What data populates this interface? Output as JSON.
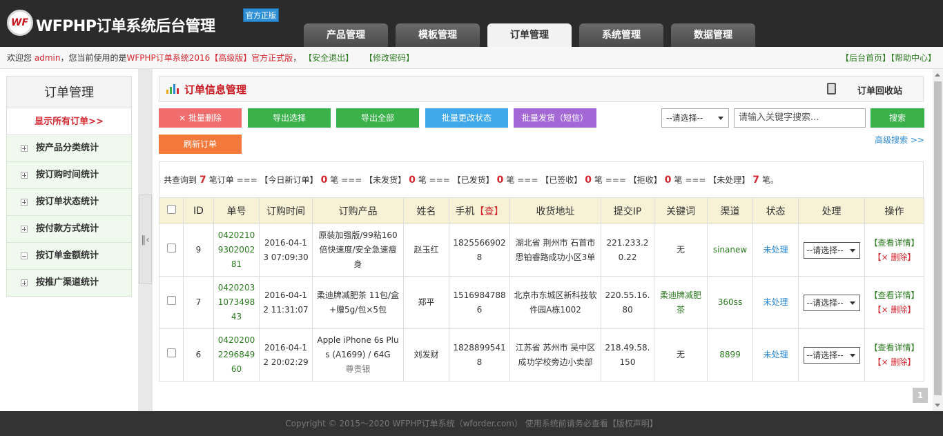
{
  "header": {
    "logo_mark": "WF",
    "logo_text": "WFPHP订单系统后台管理",
    "badge": "官方正版",
    "tabs": [
      "产品管理",
      "模板管理",
      "订单管理",
      "系统管理",
      "数据管理"
    ],
    "active_tab": "订单管理"
  },
  "infobar": {
    "welcome": "欢迎您",
    "user": "admin",
    "using": "，您当前使用的是",
    "edition": "WFPHP订单系统2016【高级版】官方正式版",
    "comma": "，",
    "logout": "【安全退出】",
    "change_pwd": "【修改密码】",
    "home": "【后台首页】",
    "help": "【帮助中心】"
  },
  "sidebar": {
    "title": "订单管理",
    "all_orders": "显示所有订单>>",
    "items": [
      {
        "label": "按产品分类统计",
        "state": "plus"
      },
      {
        "label": "按订购时间统计",
        "state": "plus"
      },
      {
        "label": "按订单状态统计",
        "state": "plus"
      },
      {
        "label": "按付款方式统计",
        "state": "plus"
      },
      {
        "label": "按订单金额统计",
        "state": "minus"
      },
      {
        "label": "按推广渠道统计",
        "state": "plus"
      }
    ]
  },
  "panel": {
    "title": "订单信息管理",
    "recycle_bin": "订单回收站"
  },
  "toolbar": {
    "batch_delete": "× 批量删除",
    "export_selected": "导出选择",
    "export_all": "导出全部",
    "batch_status": "批量更改状态",
    "batch_ship": "批量发货（短信）",
    "refresh": "刷新订单",
    "select_default": "--请选择--",
    "search_placeholder": "请输入关键字搜索...",
    "search_button": "搜索",
    "advanced_search": "高级搜索 >>"
  },
  "stats": {
    "prefix": "共查询到",
    "total": "7",
    "t1": "笔订单 === 【今日新订单】",
    "today": "0",
    "t2": "笔 === 【未发货】",
    "unshipped": "0",
    "t3": "笔 === 【已发货】",
    "shipped": "0",
    "t4": "笔 === 【已签收】",
    "signed": "0",
    "t5": "笔 === 【拒收】",
    "rejected": "0",
    "t6": "笔 === 【未处理】",
    "pending": "7",
    "t7": "笔。"
  },
  "table": {
    "columns": [
      "ID",
      "单号",
      "订购时间",
      "订购产品",
      "姓名",
      "手机",
      "【查】",
      "收货地址",
      "提交IP",
      "关键词",
      "渠道",
      "状态",
      "处理",
      "操作"
    ],
    "rows": [
      {
        "id": "9",
        "order_no": "04202109302002 81",
        "time": "2016-04-13 07:09:30",
        "product": "原装加强版/99粘160倍快速度/安全急速瘦身",
        "name": "赵玉红",
        "phone": "18255669028",
        "address": "湖北省 荆州市 石首市 思铂睿路成功小区3单",
        "ip": "221.233.20.22",
        "keyword": "无",
        "channel": "sinanew",
        "status": "未处理",
        "process": "--请选择--",
        "view": "【查看详情】",
        "delete": "【× 删除】"
      },
      {
        "id": "7",
        "order_no": "04202031073498 43",
        "time": "2016-04-12 11:31:07",
        "product": "柔迪牌减肥茶 11包/盒+赠5g/包×5包",
        "name": "郑平",
        "phone": "15169847886",
        "address": "北京市东城区新科技软件园A栋1002",
        "ip": "220.55.16.80",
        "keyword": "柔迪牌减肥茶",
        "channel": "360ss",
        "status": "未处理",
        "process": "--请选择--",
        "view": "【查看详情】",
        "delete": "【× 删除】"
      },
      {
        "id": "6",
        "order_no": "04202002296849 60",
        "time": "2016-04-12 20:02:29",
        "product": "Apple iPhone 6s Plus (A1699) / 64G",
        "product_extra": "尊贵银",
        "name": "刘发财",
        "phone": "18288995418",
        "address": "江苏省 苏州市 吴中区 成功学校旁边小卖部",
        "ip": "218.49.58.150",
        "keyword": "无",
        "channel": "8899",
        "status": "未处理",
        "process": "--请选择--",
        "view": "【查看详情】",
        "delete": "【× 删除】"
      }
    ]
  },
  "pagination": {
    "current": "1"
  },
  "footer": "Copyright © 2015～2020   WFPHP订单系统（wforder.com）   使用系统前请务必查看【版权声明】",
  "colors": {
    "red": "#d3272f",
    "green_btn": "#3bb14a",
    "blue_btn": "#3ea8ea",
    "purple_btn": "#a367d6",
    "orange_btn": "#f37a3b",
    "pink_btn": "#f16d6d"
  }
}
